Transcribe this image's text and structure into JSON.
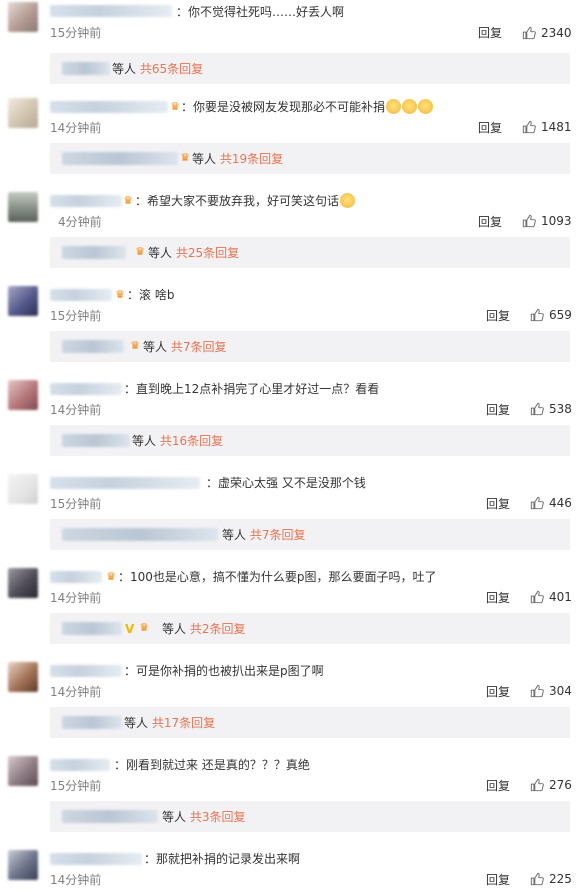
{
  "comments": [
    {
      "text": "：你不觉得社死吗……好丢人啊",
      "time": "15分钟前",
      "reply": "回复",
      "likes": "2340",
      "sub": {
        "prefix": "等人",
        "count": "共65条回复"
      }
    },
    {
      "text": "：你要是没被网友发现那必不可能补捐",
      "time": "14分钟前",
      "reply": "回复",
      "likes": "1481",
      "sub": {
        "prefix": "等人",
        "count": "共19条回复"
      }
    },
    {
      "text": "：希望大家不要放弃我，好可笑这句话",
      "time": "4分钟前",
      "reply": "回复",
      "likes": "1093",
      "sub": {
        "prefix": "等人",
        "count": "共25条回复"
      }
    },
    {
      "text": "：滚 啥b",
      "time": "15分钟前",
      "reply": "回复",
      "likes": "659",
      "sub": {
        "prefix": "等人",
        "count": "共7条回复"
      }
    },
    {
      "text": "：直到晚上12点补捐完了心里才好过一点？看看",
      "time": "14分钟前",
      "reply": "回复",
      "likes": "538",
      "sub": {
        "prefix": "等人",
        "count": "共16条回复"
      }
    },
    {
      "text": "：虚荣心太强 又不是没那个钱",
      "time": "15分钟前",
      "reply": "回复",
      "likes": "446",
      "sub": {
        "prefix": "等人",
        "count": "共7条回复"
      }
    },
    {
      "text": "：100也是心意，搞不懂为什么要p图，那么要面子吗，吐了",
      "time": "14分钟前",
      "reply": "回复",
      "likes": "401",
      "sub": {
        "prefix": "等人",
        "count": "共2条回复"
      }
    },
    {
      "text": "：可是你补捐的也被扒出来是p图了啊",
      "time": "14分钟前",
      "reply": "回复",
      "likes": "304",
      "sub": {
        "prefix": "等人",
        "count": "共17条回复"
      }
    },
    {
      "text": "：刚看到就过来 还是真的？？？真绝",
      "time": "15分钟前",
      "reply": "回复",
      "likes": "276",
      "sub": {
        "prefix": "等人",
        "count": "共3条回复"
      }
    },
    {
      "text": "：那就把补捐的记录发出来啊",
      "time": "14分钟前",
      "reply": "回复",
      "likes": "225"
    }
  ],
  "icons": {
    "like": "thumbs-up-icon",
    "badge": "member-badge-icon",
    "emoji": "smiley-emoji-icon"
  },
  "colors": {
    "link": "#eb7350",
    "subbar": "#f2f2f5",
    "time": "#808080"
  }
}
